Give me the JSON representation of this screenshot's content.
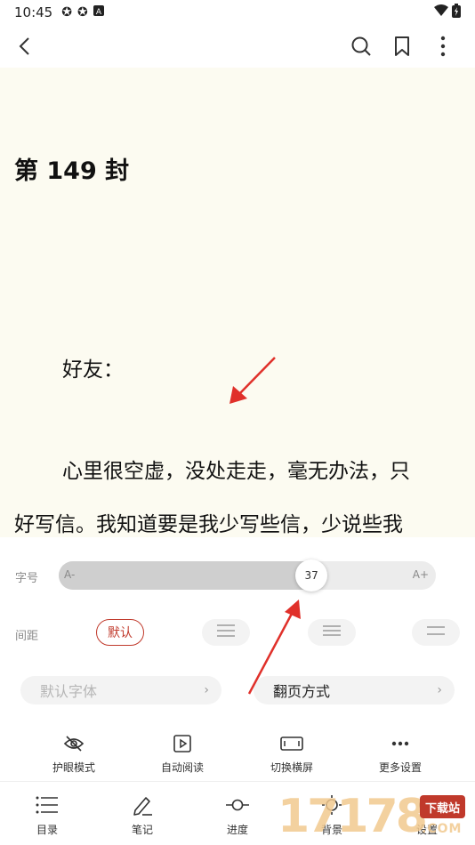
{
  "status_bar": {
    "time": "10:45"
  },
  "reader": {
    "chapter_title": "第 149 封",
    "lines": [
      "好友：",
      "心里很空虚，没处走走，毫无办法，只",
      "好写信。我知道要是我少写些信，少说些我"
    ]
  },
  "settings": {
    "font_size_label": "字号",
    "font_size_min": "A-",
    "font_size_max": "A+",
    "font_size_value": "37",
    "font_size_fraction": 0.67,
    "spacing_label": "间距",
    "spacing_default": "默认",
    "font_face_label": "默认字体",
    "page_mode_label": "翻页方式",
    "quick_actions": [
      {
        "label": "护眼模式",
        "icon": "eye-off-icon"
      },
      {
        "label": "自动阅读",
        "icon": "play-icon"
      },
      {
        "label": "切换横屏",
        "icon": "landscape-icon"
      },
      {
        "label": "更多设置",
        "icon": "more-icon"
      }
    ]
  },
  "bottom_nav": [
    {
      "label": "目录",
      "icon": "list-icon"
    },
    {
      "label": "笔记",
      "icon": "pencil-icon"
    },
    {
      "label": "进度",
      "icon": "progress-icon"
    },
    {
      "label": "背景",
      "icon": "brightness-icon"
    },
    {
      "label": "设置",
      "icon": "settings-icon"
    }
  ],
  "watermark": {
    "digits": "17178",
    "badge": "下载站",
    "sub": ".COM"
  },
  "colors": {
    "accent": "#c0392b",
    "reader_bg": "#fcfbf1",
    "annotation": "#e0302a"
  }
}
